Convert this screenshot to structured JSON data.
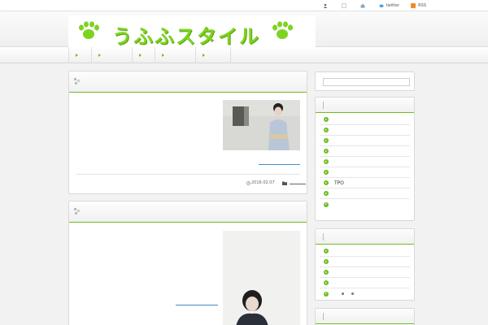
{
  "topbar": {
    "items": [
      {
        "icon": "user-icon",
        "label": ""
      },
      {
        "icon": "page-icon",
        "label": ""
      },
      {
        "icon": "home-icon",
        "label": ""
      },
      {
        "icon": "twitter-icon",
        "label": "twitter"
      },
      {
        "icon": "rss-icon",
        "label": "RSS"
      }
    ]
  },
  "header": {
    "logo_text": "うふふスタイル",
    "logo_color": "#7ed321"
  },
  "nav": {
    "items": [
      "",
      "",
      "",
      "",
      ""
    ]
  },
  "search": {
    "placeholder": ""
  },
  "posts": [
    {
      "title": "",
      "date": "2016.02.07",
      "category": ""
    },
    {
      "title": ""
    }
  ],
  "sidebar": {
    "widget1": {
      "title": "",
      "items": [
        "",
        "",
        "",
        "",
        "",
        "",
        "TPO",
        "",
        ""
      ]
    },
    "widget2": {
      "title": "",
      "items": [
        "",
        "",
        "",
        "",
        ""
      ]
    },
    "widget3": {
      "title": ""
    }
  },
  "colors": {
    "accent": "#6dbf1f",
    "link": "#3a8fd0"
  }
}
